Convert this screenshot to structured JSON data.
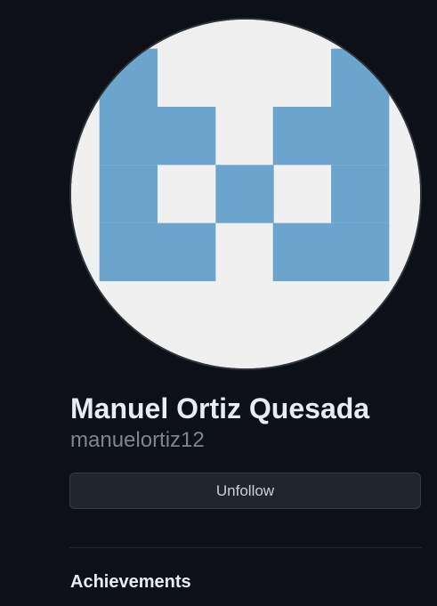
{
  "profile": {
    "name": "Manuel Ortiz Quesada",
    "username": "manuelortiz12",
    "avatar": {
      "kind": "identicon",
      "foreground": "#6ba4cc",
      "background": "#f0f0f0"
    }
  },
  "actions": {
    "follow_label": "Unfollow"
  },
  "sections": {
    "achievements_title": "Achievements"
  },
  "colors": {
    "page_background": "#0d1117",
    "button_background": "#21262d",
    "button_border": "#363b42",
    "name_text": "#e6edf3",
    "username_text": "#7d8590"
  }
}
